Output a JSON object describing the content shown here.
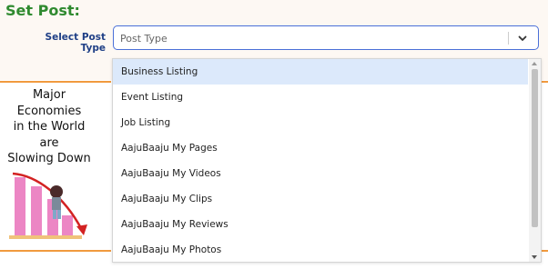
{
  "form": {
    "title": "Set Post:",
    "select_label": "Select Post Type",
    "select_value": "Post Type"
  },
  "banner": {
    "text_lines": [
      "Major",
      "Economies",
      "in the World",
      "are",
      "Slowing Down"
    ]
  },
  "dropdown": {
    "highlighted": "Business Listing",
    "options": [
      "Business Listing",
      "Event Listing",
      "Job Listing",
      "AajuBaaju My Pages",
      "AajuBaaju My Videos",
      "AajuBaaju My Clips",
      "AajuBaaju My Reviews",
      "AajuBaaju My Photos"
    ]
  },
  "colors": {
    "title_green": "#2f8a2f",
    "label_navy": "#1f3f86",
    "focus_border": "#4a6fd8",
    "highlight": "#dce9fb",
    "banner_orange": "#f19a3e",
    "bar_pink": "#ec86c4"
  },
  "icons": {
    "select_caret": "chevron-down-icon",
    "illustration": "declining-economy-chart-illustration"
  }
}
